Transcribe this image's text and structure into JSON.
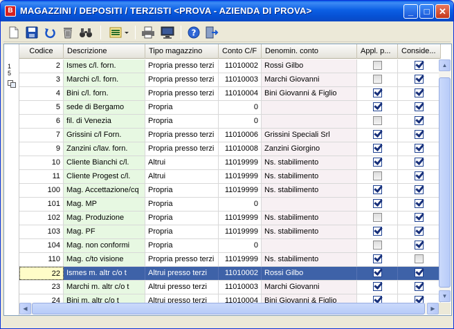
{
  "window": {
    "title": "MAGAZZINI / DEPOSITI / TERZISTI <PROVA - AZIENDA DI PROVA>",
    "app_icon_letter": "B",
    "minimize_glyph": "_",
    "maximize_glyph": "□",
    "close_glyph": "✕"
  },
  "toolbar": {
    "icons": [
      "new-document-icon",
      "save-icon",
      "undo-icon",
      "delete-icon",
      "binoculars-icon",
      "grid-settings-icon",
      "print-icon",
      "monitor-icon",
      "help-icon",
      "exit-icon"
    ]
  },
  "indicator": {
    "line1": "1",
    "line2": "5"
  },
  "grid": {
    "columns": [
      "Codice",
      "Descrizione",
      "Tipo magazzino",
      "Conto C/F",
      "Denomin. conto",
      "Appl. p...",
      "Conside..."
    ],
    "rows": [
      {
        "codice": "2",
        "descrizione": "Ismes c/l. forn.",
        "tipo": "Propria presso terzi",
        "conto": "11010002",
        "denom": "Rossi Gilbo",
        "appl": false,
        "cons": true
      },
      {
        "codice": "3",
        "descrizione": "Marchi c/l. forn.",
        "tipo": "Propria presso terzi",
        "conto": "11010003",
        "denom": "Marchi Giovanni",
        "appl": false,
        "cons": true
      },
      {
        "codice": "4",
        "descrizione": "Bini c/l. forn.",
        "tipo": "Propria presso terzi",
        "conto": "11010004",
        "denom": "Bini Giovanni & Figlio",
        "appl": true,
        "cons": true
      },
      {
        "codice": "5",
        "descrizione": "sede di Bergamo",
        "tipo": "Propria",
        "conto": "0",
        "denom": "",
        "appl": true,
        "cons": true
      },
      {
        "codice": "6",
        "descrizione": "fil. di Venezia",
        "tipo": "Propria",
        "conto": "0",
        "denom": "",
        "appl": false,
        "cons": true
      },
      {
        "codice": "7",
        "descrizione": "Grissini c/l Forn.",
        "tipo": "Propria presso terzi",
        "conto": "11010006",
        "denom": "Grissini Speciali Srl",
        "appl": true,
        "cons": true
      },
      {
        "codice": "9",
        "descrizione": "Zanzini c/lav. forn.",
        "tipo": "Propria presso terzi",
        "conto": "11010008",
        "denom": "Zanzini Giorgino",
        "appl": true,
        "cons": true
      },
      {
        "codice": "10",
        "descrizione": "Cliente Bianchi c/l.",
        "tipo": "Altrui",
        "conto": "11019999",
        "denom": "Ns. stabilimento",
        "appl": true,
        "cons": true
      },
      {
        "codice": "11",
        "descrizione": "Cliente Progest c/l.",
        "tipo": "Altrui",
        "conto": "11019999",
        "denom": "Ns. stabilimento",
        "appl": false,
        "cons": true
      },
      {
        "codice": "100",
        "descrizione": "Mag. Accettazione/cq",
        "tipo": "Propria",
        "conto": "11019999",
        "denom": "Ns. stabilimento",
        "appl": true,
        "cons": true
      },
      {
        "codice": "101",
        "descrizione": "Mag. MP",
        "tipo": "Propria",
        "conto": "0",
        "denom": "",
        "appl": true,
        "cons": true
      },
      {
        "codice": "102",
        "descrizione": "Mag. Produzione",
        "tipo": "Propria",
        "conto": "11019999",
        "denom": "Ns. stabilimento",
        "appl": false,
        "cons": true
      },
      {
        "codice": "103",
        "descrizione": "Mag. PF",
        "tipo": "Propria",
        "conto": "11019999",
        "denom": "Ns. stabilimento",
        "appl": true,
        "cons": true
      },
      {
        "codice": "104",
        "descrizione": "Mag. non conformi",
        "tipo": "Propria",
        "conto": "0",
        "denom": "",
        "appl": false,
        "cons": true
      },
      {
        "codice": "110",
        "descrizione": "Mag. c/to visione",
        "tipo": "Propria presso terzi",
        "conto": "11019999",
        "denom": "Ns. stabilimento",
        "appl": true,
        "cons": false
      },
      {
        "codice": "22",
        "descrizione": "Ismes m. altr c/o t",
        "tipo": "Altrui presso terzi",
        "conto": "11010002",
        "denom": "Rossi Gilbo",
        "appl": true,
        "cons": true,
        "selected": true
      },
      {
        "codice": "23",
        "descrizione": "Marchi m. altr c/o t",
        "tipo": "Altrui presso terzi",
        "conto": "11010003",
        "denom": "Marchi Giovanni",
        "appl": true,
        "cons": true
      },
      {
        "codice": "24",
        "descrizione": "Bini m. altr c/o t",
        "tipo": "Altrui presso terzi",
        "conto": "11010004",
        "denom": "Bini Giovanni & Figlio",
        "appl": true,
        "cons": true
      }
    ]
  }
}
